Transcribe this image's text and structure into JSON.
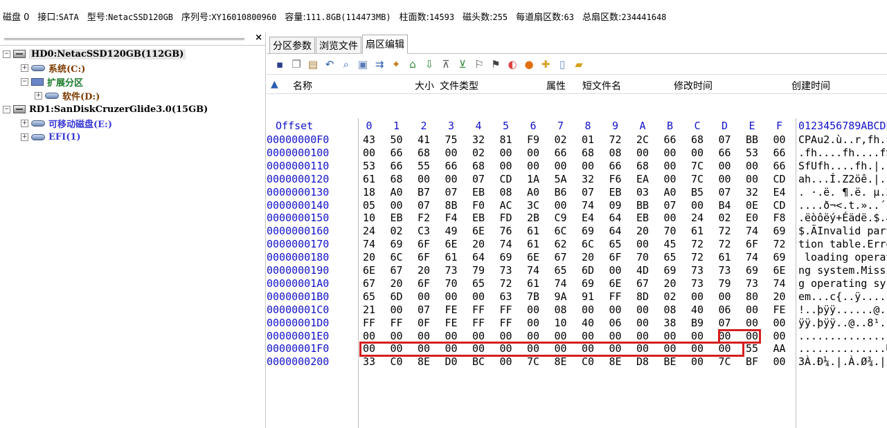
{
  "infobar": {
    "disk": "磁盘 0",
    "interface_label": "接口:",
    "interface": "SATA",
    "model_label": "型号:",
    "model": "NetacSSD120GB",
    "serial_label": "序列号:",
    "serial": "XY16010800960",
    "capacity_label": "容量:",
    "capacity": "111.8GB(114473MB)",
    "cylinders_label": "柱面数:",
    "cylinders": "14593",
    "heads_label": "磁头数:",
    "heads": "255",
    "sectors_label": "每道扇区数:",
    "sectors": "63",
    "total_label": "总扇区数:",
    "total": "234441648"
  },
  "tree": {
    "close": "×",
    "hd0": "HD0:NetacSSD120GB(112GB)",
    "system": "系统(C:)",
    "extended": "扩展分区",
    "software": "软件(D:)",
    "rd1": "RD1:SanDiskCruzerGlide3.0(15GB)",
    "removable": "可移动磁盘(E:)",
    "efi": "EFI(1)"
  },
  "tabs": [
    "分区参数",
    "浏览文件",
    "扇区编辑"
  ],
  "toolbar_icons": [
    "save-icon",
    "copy-icon",
    "paste-icon",
    "undo-icon",
    "search-icon",
    "find-file-icon",
    "goto-icon",
    "jump-start-icon",
    "partition-icon",
    "download-icon",
    "backup-icon",
    "save-partition-icon",
    "bookmark-icon",
    "bookmark2-icon",
    "refresh-icon",
    "color-icon",
    "tools-icon",
    "page-icon",
    "open-folder-icon"
  ],
  "columns": {
    "up": "名称",
    "size": "大小",
    "type": "文件类型",
    "attr": "属性",
    "short": "短文件名",
    "mtime": "修改时间",
    "ctime": "创建时间"
  },
  "hex_header": {
    "offset": "Offset",
    "cols": [
      "0",
      "1",
      "2",
      "3",
      "4",
      "5",
      "6",
      "7",
      "8",
      "9",
      "A",
      "B",
      "C",
      "D",
      "E",
      "F"
    ],
    "ascii": "0123456789ABCDEF"
  },
  "hex_rows": [
    {
      "off": "00000000F0",
      "bytes": [
        "43",
        "50",
        "41",
        "75",
        "32",
        "81",
        "F9",
        "02",
        "01",
        "72",
        "2C",
        "66",
        "68",
        "07",
        "BB",
        "00"
      ],
      "ascii": "CPAu2.ù..r,fh.»."
    },
    {
      "off": "0000000100",
      "bytes": [
        "00",
        "66",
        "68",
        "00",
        "02",
        "00",
        "00",
        "66",
        "68",
        "08",
        "00",
        "00",
        "00",
        "66",
        "53",
        "66"
      ],
      "ascii": ".fh....fh....fSf"
    },
    {
      "off": "0000000110",
      "bytes": [
        "53",
        "66",
        "55",
        "66",
        "68",
        "00",
        "00",
        "00",
        "00",
        "66",
        "68",
        "00",
        "7C",
        "00",
        "00",
        "66"
      ],
      "ascii": "SfUfh....fh.|..f"
    },
    {
      "off": "0000000120",
      "bytes": [
        "61",
        "68",
        "00",
        "00",
        "07",
        "CD",
        "1A",
        "5A",
        "32",
        "F6",
        "EA",
        "00",
        "7C",
        "00",
        "00",
        "CD"
      ],
      "ascii": "ah...Í.Z2öê.|..Í"
    },
    {
      "off": "0000000130",
      "bytes": [
        "18",
        "A0",
        "B7",
        "07",
        "EB",
        "08",
        "A0",
        "B6",
        "07",
        "EB",
        "03",
        "A0",
        "B5",
        "07",
        "32",
        "E4"
      ],
      "ascii": ". ·.ë. ¶.ë. µ.2ä"
    },
    {
      "off": "0000000140",
      "bytes": [
        "05",
        "00",
        "07",
        "8B",
        "F0",
        "AC",
        "3C",
        "00",
        "74",
        "09",
        "BB",
        "07",
        "00",
        "B4",
        "0E",
        "CD"
      ],
      "ascii": "....ð¬<.t.»..´.Í"
    },
    {
      "off": "0000000150",
      "bytes": [
        "10",
        "EB",
        "F2",
        "F4",
        "EB",
        "FD",
        "2B",
        "C9",
        "E4",
        "64",
        "EB",
        "00",
        "24",
        "02",
        "E0",
        "F8"
      ],
      "ascii": ".ëòôëý+Éädë.$.àø"
    },
    {
      "off": "0000000160",
      "bytes": [
        "24",
        "02",
        "C3",
        "49",
        "6E",
        "76",
        "61",
        "6C",
        "69",
        "64",
        "20",
        "70",
        "61",
        "72",
        "74",
        "69"
      ],
      "ascii": "$.ÃInvalid parti"
    },
    {
      "off": "0000000170",
      "bytes": [
        "74",
        "69",
        "6F",
        "6E",
        "20",
        "74",
        "61",
        "62",
        "6C",
        "65",
        "00",
        "45",
        "72",
        "72",
        "6F",
        "72"
      ],
      "ascii": "tion table.Error"
    },
    {
      "off": "0000000180",
      "bytes": [
        "20",
        "6C",
        "6F",
        "61",
        "64",
        "69",
        "6E",
        "67",
        "20",
        "6F",
        "70",
        "65",
        "72",
        "61",
        "74",
        "69"
      ],
      "ascii": " loading operati"
    },
    {
      "off": "0000000190",
      "bytes": [
        "6E",
        "67",
        "20",
        "73",
        "79",
        "73",
        "74",
        "65",
        "6D",
        "00",
        "4D",
        "69",
        "73",
        "73",
        "69",
        "6E"
      ],
      "ascii": "ng system.Missin"
    },
    {
      "off": "00000001A0",
      "bytes": [
        "67",
        "20",
        "6F",
        "70",
        "65",
        "72",
        "61",
        "74",
        "69",
        "6E",
        "67",
        "20",
        "73",
        "79",
        "73",
        "74"
      ],
      "ascii": "g operating syst"
    },
    {
      "off": "00000001B0",
      "bytes": [
        "65",
        "6D",
        "00",
        "00",
        "00",
        "63",
        "7B",
        "9A",
        "91",
        "FF",
        "8D",
        "02",
        "00",
        "00",
        "80",
        "20"
      ],
      "ascii": "em...c{..ÿ....."
    },
    {
      "off": "00000001C0",
      "bytes": [
        "21",
        "00",
        "07",
        "FE",
        "FF",
        "FF",
        "00",
        "08",
        "00",
        "00",
        "00",
        "08",
        "40",
        "06",
        "00",
        "FE"
      ],
      "ascii": "!..þÿÿ......@..þ"
    },
    {
      "off": "00000001D0",
      "bytes": [
        "FF",
        "FF",
        "0F",
        "FE",
        "FF",
        "FF",
        "00",
        "10",
        "40",
        "06",
        "00",
        "38",
        "B9",
        "07",
        "00",
        "00"
      ],
      "ascii": "ÿÿ.þÿÿ..@..8¹..."
    },
    {
      "off": "00000001E0",
      "bytes": [
        "00",
        "00",
        "00",
        "00",
        "00",
        "00",
        "00",
        "00",
        "00",
        "00",
        "00",
        "00",
        "00",
        "00",
        "00",
        "00"
      ],
      "ascii": "................"
    },
    {
      "off": "00000001F0",
      "bytes": [
        "00",
        "00",
        "00",
        "00",
        "00",
        "00",
        "00",
        "00",
        "00",
        "00",
        "00",
        "00",
        "00",
        "00",
        "55",
        "AA"
      ],
      "ascii": "..............Uª"
    },
    {
      "off": "0000000200",
      "bytes": [
        "33",
        "C0",
        "8E",
        "D0",
        "BC",
        "00",
        "7C",
        "8E",
        "C0",
        "8E",
        "D8",
        "BE",
        "00",
        "7C",
        "BF",
        "00"
      ],
      "ascii": "3À.Ð¼.|.À.Ø¾.|¿."
    }
  ],
  "colors": {
    "offset": "#1212c8",
    "highlight": "#d51e1e"
  }
}
